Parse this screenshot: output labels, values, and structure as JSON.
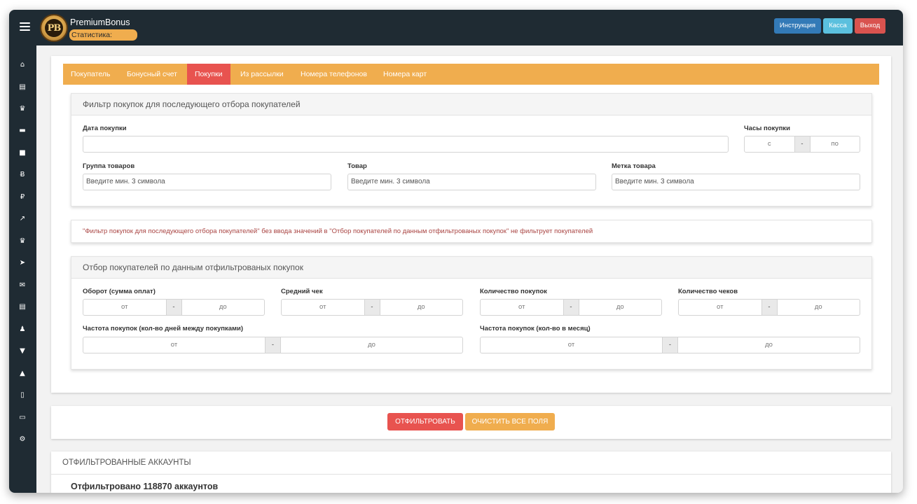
{
  "header": {
    "brand": "PremiumBonus",
    "logo_text": "PB",
    "stat_badge": "Статистика:",
    "btn_instruction": "Инструкция",
    "btn_kassa": "Касса",
    "btn_exit": "Выход"
  },
  "sidebar": {
    "icons": [
      "home-icon",
      "ticket-icon",
      "crown-icon",
      "cart-icon",
      "book-icon",
      "bitcoin-icon",
      "ruble-icon",
      "trend-icon",
      "crown-icon",
      "send-icon",
      "mail-icon",
      "ticket-icon",
      "users-icon",
      "tshirt-icon",
      "road-icon",
      "mobile-icon",
      "card-icon",
      "gear-icon"
    ],
    "glyphs": [
      "⌂",
      "▤",
      "♛",
      "▬",
      "■",
      "Ƀ",
      "₽",
      "↗",
      "♛",
      "➤",
      "✉",
      "▤",
      "♟",
      "▼",
      "▲",
      "▯",
      "▭",
      "⚙"
    ]
  },
  "tabs": [
    "Покупатель",
    "Бонусный счет",
    "Покупки",
    "Из рассылки",
    "Номера телефонов",
    "Номера карт"
  ],
  "active_tab": "Покупки",
  "purchase_filter": {
    "title": "Фильтр покупок для последующего отбора покупателей",
    "date_label": "Дата покупки",
    "hours_label": "Часы покупки",
    "hours_from": "с",
    "hours_sep": "-",
    "hours_to": "по",
    "group_label": "Группа товаров",
    "group_placeholder": "Введите мин. 3 символа",
    "product_label": "Товар",
    "product_placeholder": "Введите мин. 3 символа",
    "tag_label": "Метка товара",
    "tag_placeholder": "Введите мин. 3 символа"
  },
  "note": "\"Фильтр покупок для последующего отбора покупателей\" без ввода значений в \"Отбор покупателей по данным отфильтрованых покупок\" не фильтрует покупателей",
  "buyer_selection": {
    "title": "Отбор покупателей по данным отфильтрованых покупок",
    "from": "от",
    "sep": "-",
    "to": "до",
    "turnover_label": "Оборот (сумма оплат)",
    "avg_check_label": "Средний чек",
    "purchases_count_label": "Количество покупок",
    "checks_count_label": "Количество чеков",
    "freq_days_label": "Частота покупок (кол-во дней между покупками)",
    "freq_month_label": "Частота покупок (кол-во в месяц)"
  },
  "actions": {
    "filter": "ОТФИЛЬТРОВАТЬ",
    "clear": "ОЧИСТИТЬ ВСЕ ПОЛЯ"
  },
  "results": {
    "title": "ОТФИЛЬТРОВАННЫЕ АККАУНТЫ",
    "count_text": "Отфильтровано 118870 аккаунтов"
  },
  "colors": {
    "topbar": "#1f2b33",
    "tabs": "#f0ad4e",
    "active_tab": "#e8534f",
    "note_text": "#a94442"
  }
}
